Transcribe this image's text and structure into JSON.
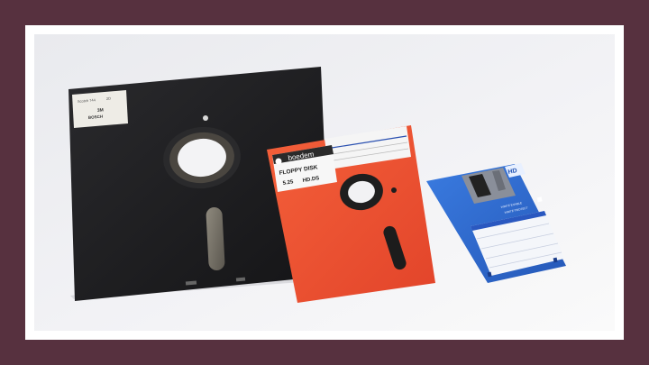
{
  "photo": {
    "eight_inch": {
      "label_line1": "Scotch 744",
      "label_line2": "2D",
      "label_brand": "3M",
      "label_line3": "BOSCH"
    },
    "five_inch": {
      "brand": "boedem",
      "title": "FLOPPY DISK",
      "size": "5.25",
      "density": "HD.DS"
    },
    "three_inch": {
      "hd_badge": "HD",
      "write_enable": "WRITE ENABLE",
      "write_protect": "WRITE PROTECT"
    }
  },
  "colors": {
    "border": "#57313f",
    "eight_inch_disk": "#1c1c1e",
    "five_inch_disk": "#f0502e",
    "three_inch_disk": "#2f6ed6"
  }
}
